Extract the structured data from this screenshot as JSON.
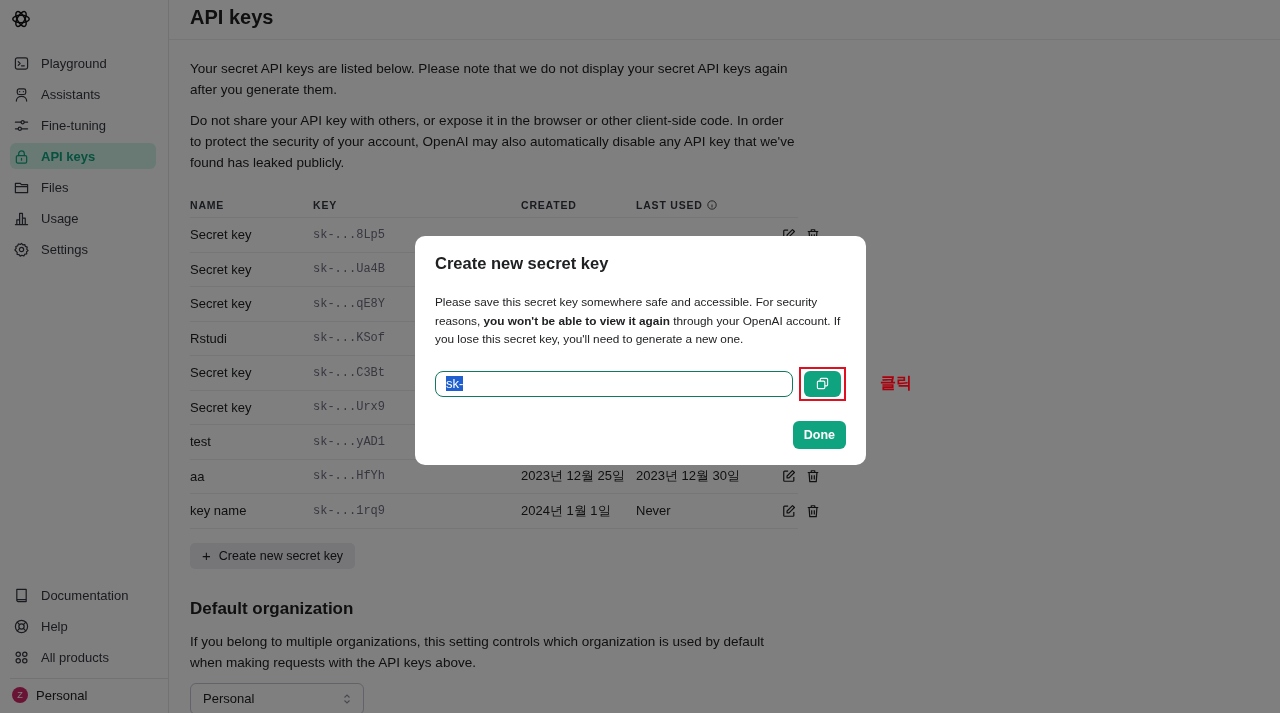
{
  "sidebar": {
    "items": [
      {
        "label": "Playground",
        "selected": false
      },
      {
        "label": "Assistants",
        "selected": false
      },
      {
        "label": "Fine-tuning",
        "selected": false
      },
      {
        "label": "API keys",
        "selected": true
      },
      {
        "label": "Files",
        "selected": false
      },
      {
        "label": "Usage",
        "selected": false
      },
      {
        "label": "Settings",
        "selected": false
      }
    ],
    "bottom_items": [
      {
        "label": "Documentation"
      },
      {
        "label": "Help"
      },
      {
        "label": "All products"
      }
    ],
    "account": {
      "initial": "Z",
      "name": "Personal"
    }
  },
  "page": {
    "title": "API keys",
    "paragraphs": [
      "Your secret API keys are listed below. Please note that we do not display your secret API keys again after you generate them.",
      "Do not share your API key with others, or expose it in the browser or other client-side code. In order to protect the security of your account, OpenAI may also automatically disable any API key that we've found has leaked publicly."
    ],
    "table": {
      "columns": [
        "NAME",
        "KEY",
        "CREATED",
        "LAST USED"
      ],
      "rows": [
        {
          "name": "Secret key",
          "key": "sk-...8Lp5",
          "actions": true
        },
        {
          "name": "Secret key",
          "key": "sk-...Ua4B",
          "actions": false
        },
        {
          "name": "Secret key",
          "key": "sk-...qE8Y",
          "actions": false
        },
        {
          "name": "Rstudi",
          "key": "sk-...KSof",
          "actions": false
        },
        {
          "name": "Secret key",
          "key": "sk-...C3Bt",
          "actions": false
        },
        {
          "name": "Secret key",
          "key": "sk-...Urx9",
          "actions": false
        },
        {
          "name": "test",
          "key": "sk-...yAD1",
          "actions": false
        },
        {
          "name": "aa",
          "key": "sk-...HfYh",
          "created": "2023년 12월 25일",
          "last_used": "2023년 12월 30일",
          "actions": true
        },
        {
          "name": "key name",
          "key": "sk-...1rq9",
          "created": "2024년 1월 1일",
          "last_used": "Never",
          "actions": true
        }
      ]
    },
    "create_button": {
      "icon": "+",
      "label": "Create new secret key"
    },
    "org_title": "Default organization",
    "org_text": "If you belong to multiple organizations, this setting controls which organization is used by default when making requests with the API keys above.",
    "org_select": "Personal"
  },
  "dialog": {
    "title": "Create new secret key",
    "text": "Please save this secret key somewhere safe and accessible. For security reasons, **you won't be able to view it again** through your OpenAI account. If you lose this secret key, you'll need to generate a new one.",
    "key_value": "sk-",
    "done_button": "Done",
    "annotation": "클릭"
  }
}
